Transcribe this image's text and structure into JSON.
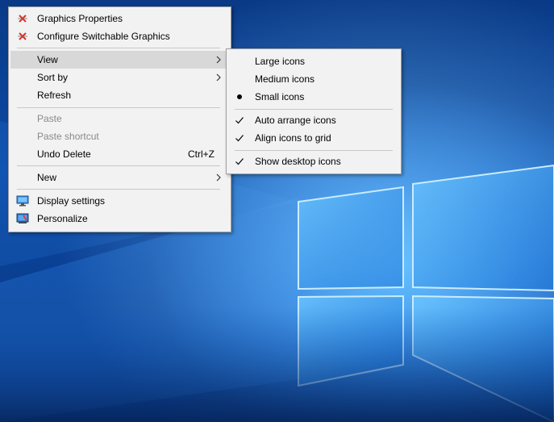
{
  "context_menu": {
    "items": [
      {
        "label": "Graphics Properties"
      },
      {
        "label": "Configure Switchable Graphics"
      },
      {
        "label": "View"
      },
      {
        "label": "Sort by"
      },
      {
        "label": "Refresh"
      },
      {
        "label": "Paste"
      },
      {
        "label": "Paste shortcut"
      },
      {
        "label": "Undo Delete",
        "shortcut": "Ctrl+Z"
      },
      {
        "label": "New"
      },
      {
        "label": "Display settings"
      },
      {
        "label": "Personalize"
      }
    ]
  },
  "view_submenu": {
    "items": [
      {
        "label": "Large icons"
      },
      {
        "label": "Medium icons"
      },
      {
        "label": "Small icons",
        "selected": true
      },
      {
        "label": "Auto arrange icons",
        "checked": true
      },
      {
        "label": "Align icons to grid",
        "checked": true
      },
      {
        "label": "Show desktop icons",
        "checked": true
      }
    ]
  },
  "colors": {
    "menu_background": "#f2f2f2",
    "menu_highlight": "#d8d8d8",
    "disabled_text": "#8a8a8a",
    "wallpaper_blue": "#0b4aa6",
    "wallpaper_glow": "#3fa9ff"
  },
  "icons": {
    "graphics_properties": "intel-graphics-icon",
    "switchable_graphics": "intel-graphics-icon",
    "display_settings": "monitor-icon",
    "personalize": "personalize-icon"
  }
}
